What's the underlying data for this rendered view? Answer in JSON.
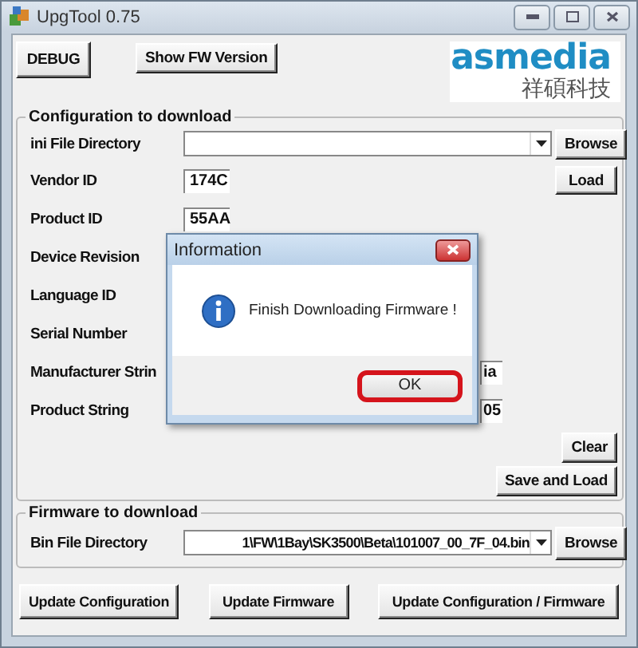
{
  "window": {
    "title": "UpgTool 0.75"
  },
  "toolbar": {
    "buttons": [
      "DEBUG",
      "Show FW Version"
    ]
  },
  "logo": {
    "brand": "asmedia",
    "subtitle": "祥碩科技"
  },
  "configuration": {
    "title": "Configuration to download",
    "fields": [
      {
        "label": "ini File Directory",
        "kind": "combo"
      },
      {
        "label": "Vendor ID",
        "kind": "text",
        "value": "174C"
      },
      {
        "label": "Product ID",
        "kind": "text",
        "value": "55AA"
      },
      {
        "label": "Device Revision",
        "kind": "hidden"
      },
      {
        "label": "Language ID",
        "kind": "hidden"
      },
      {
        "label": "Serial Number",
        "kind": "hidden"
      },
      {
        "label": "Manufacturer Strin",
        "kind": "wide",
        "value": "ia"
      },
      {
        "label": "Product String",
        "kind": "wide",
        "value": "05"
      }
    ],
    "side_buttons": [
      "Browse",
      "Load"
    ],
    "bottom_buttons": [
      "Clear",
      "Save and Load"
    ]
  },
  "firmware": {
    "title": "Firmware to download",
    "label": "Bin File Directory",
    "value": "1\\FW\\1Bay\\SK3500\\Beta\\101007_00_7F_04.bin",
    "button": "Browse"
  },
  "actions": [
    "Update Configuration",
    "Update Firmware",
    "Update Configuration / Firmware"
  ],
  "dialog": {
    "title": "Information",
    "message": "Finish Downloading Firmware !",
    "ok_button": {
      "label": "OK",
      "highlighted": true
    }
  }
}
